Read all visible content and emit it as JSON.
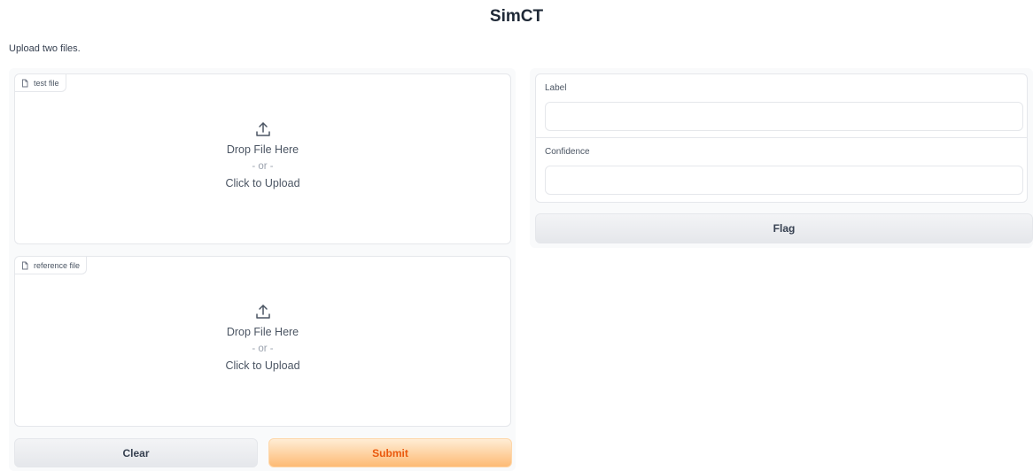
{
  "app": {
    "title": "SimCT",
    "description": "Upload two files."
  },
  "inputs": {
    "test_file": {
      "label": "test file",
      "label_icon": "file-icon",
      "upload_icon": "upload-arrow-icon",
      "drop_text": "Drop File Here",
      "or_text": "- or -",
      "click_text": "Click to Upload"
    },
    "reference_file": {
      "label": "reference file",
      "label_icon": "file-icon",
      "upload_icon": "upload-arrow-icon",
      "drop_text": "Drop File Here",
      "or_text": "- or -",
      "click_text": "Click to Upload"
    }
  },
  "actions": {
    "clear_label": "Clear",
    "submit_label": "Submit"
  },
  "outputs": {
    "label": {
      "label": "Label",
      "value": ""
    },
    "confidence": {
      "label": "Confidence",
      "value": ""
    }
  },
  "flag": {
    "label": "Flag"
  },
  "colors": {
    "primary_text": "#ea580c",
    "primary_bg_start": "#ffedd5",
    "primary_bg_end": "#fdba74",
    "secondary_bg": "#e5e7eb",
    "border": "#e5e7eb"
  }
}
